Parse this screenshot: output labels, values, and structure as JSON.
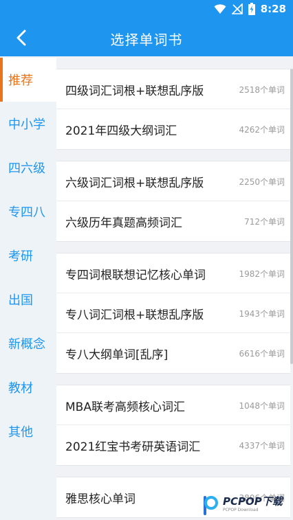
{
  "status": {
    "time": "8:28"
  },
  "header": {
    "title": "选择单词书"
  },
  "sidebar": {
    "items": [
      {
        "label": "推荐",
        "active": true
      },
      {
        "label": "中小学"
      },
      {
        "label": "四六级"
      },
      {
        "label": "专四八"
      },
      {
        "label": "考研"
      },
      {
        "label": "出国"
      },
      {
        "label": "新概念"
      },
      {
        "label": "教材"
      },
      {
        "label": "其他"
      }
    ]
  },
  "groups": [
    {
      "rows": [
        {
          "name": "四级词汇词根+联想乱序版",
          "count": "2518个单词"
        },
        {
          "name": "2021年四级大纲词汇",
          "count": "4262个单词"
        }
      ]
    },
    {
      "rows": [
        {
          "name": "六级词汇词根+联想乱序版",
          "count": "2250个单词"
        },
        {
          "name": "六级历年真题高频词汇",
          "count": "712个单词"
        }
      ]
    },
    {
      "rows": [
        {
          "name": "专四词根联想记忆核心单词",
          "count": "1982个单词"
        },
        {
          "name": "专八词汇词根+联想乱序版",
          "count": "1943个单词"
        },
        {
          "name": "专八大纲单词[乱序]",
          "count": "6616个单词"
        }
      ]
    },
    {
      "rows": [
        {
          "name": "MBA联考高频核心词汇",
          "count": "1048个单词"
        },
        {
          "name": "2021红宝书考研英语词汇",
          "count": "4337个单词"
        }
      ]
    },
    {
      "rows": [
        {
          "name": "雅思核心单词",
          "count": "3806个单词"
        }
      ]
    }
  ],
  "watermark": {
    "main": "PCPOP下载",
    "sub": "PCPOP Download"
  },
  "colors": {
    "primary": "#1e96f0",
    "accent": "#e8741c"
  }
}
